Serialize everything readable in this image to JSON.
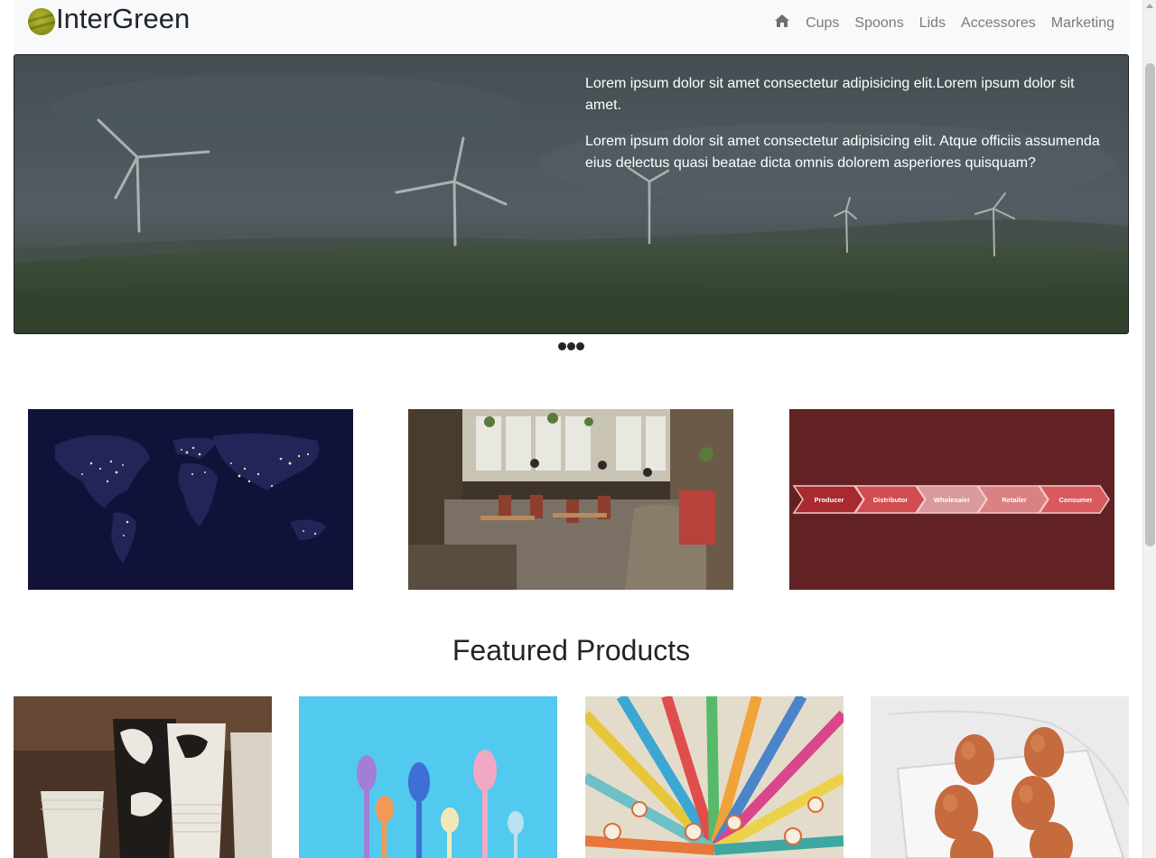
{
  "brand": {
    "name": "InterGreen"
  },
  "nav": {
    "items": [
      "Cups",
      "Spoons",
      "Lids",
      "Accessores",
      "Marketing"
    ]
  },
  "hero": {
    "paragraphs": [
      "Lorem ipsum dolor sit amet consectetur adipisicing elit.Lorem ipsum dolor sit amet.",
      "Lorem ipsum dolor sit amet consectetur adipisicing elit. Atque officiis assumenda eius delectus quasi beatae dicta omnis dolorem asperiores quisquam?"
    ],
    "slide_count": 3
  },
  "tiles": {
    "chain_steps": [
      "Producer",
      "Distributor",
      "Wholesaler",
      "Retailer",
      "Consumer"
    ]
  },
  "featured": {
    "title": "Featured Products"
  },
  "colors": {
    "navbar_bg": "#f8f9fa",
    "chain_bg": "#622223",
    "accent_logo": "#9aa021"
  }
}
